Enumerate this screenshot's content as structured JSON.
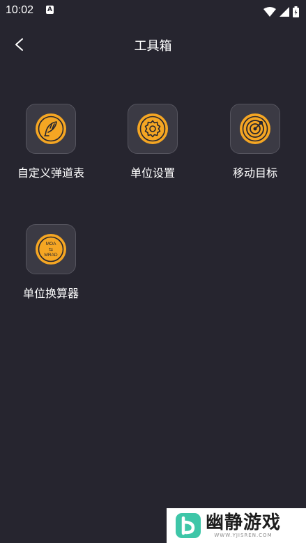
{
  "status_bar": {
    "time": "10:02",
    "notification_letter": "A"
  },
  "header": {
    "title": "工具箱"
  },
  "tools": [
    {
      "label": "自定义弹道表",
      "icon": "feather-icon"
    },
    {
      "label": "单位设置",
      "icon": "gear-icon"
    },
    {
      "label": "移动目标",
      "icon": "target-icon"
    },
    {
      "label": "单位换算器",
      "icon": "unit-converter-icon",
      "icon_text_top": "MOA",
      "icon_text_mid": "⇆",
      "icon_text_bottom": "MRAD"
    }
  ],
  "watermark": {
    "title": "幽静游戏",
    "url": "WWW.YJISREN.COM"
  },
  "colors": {
    "background": "#26252f",
    "accent": "#f5a623",
    "tile": "#3b3a44"
  }
}
